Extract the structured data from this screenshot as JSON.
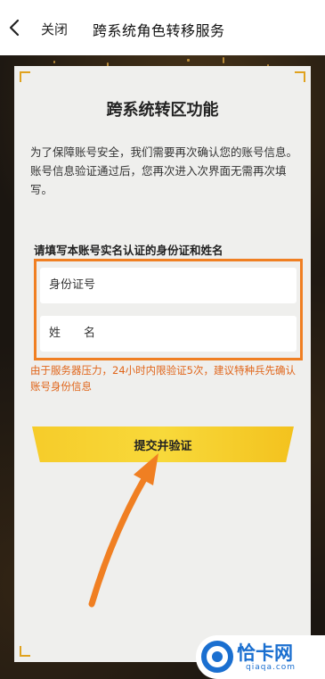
{
  "header": {
    "close_label": "关闭",
    "title": "跨系统角色转移服务"
  },
  "card": {
    "title": "跨系统转区功能",
    "intro": "为了保障账号安全，我们需要再次确认您的账号信息。账号信息验证通过后，您再次进入次界面无需再次填写。",
    "form_heading": "请填写本账号实名认证的身份证和姓名",
    "id_field_placeholder": "身份证号",
    "name_field_placeholder": "姓　　名",
    "warning": "由于服务器压力，24小时内限验证5次，建议特种兵先确认账号身份信息",
    "submit_label": "提交并验证"
  },
  "watermark": {
    "brand": "恰卡网",
    "domain": "qiaqa.com"
  },
  "colors": {
    "accent_orange": "#f07f22",
    "button_yellow": "#f6cc2a",
    "corner_gold": "#e0a21f",
    "warning_text": "#e0651a",
    "watermark_blue": "#1a6fd0"
  },
  "icons": {
    "back": "chevron-left-icon",
    "watermark_logo": "qiaka-logo-icon",
    "annotation_arrow": "arrow-annotation"
  }
}
